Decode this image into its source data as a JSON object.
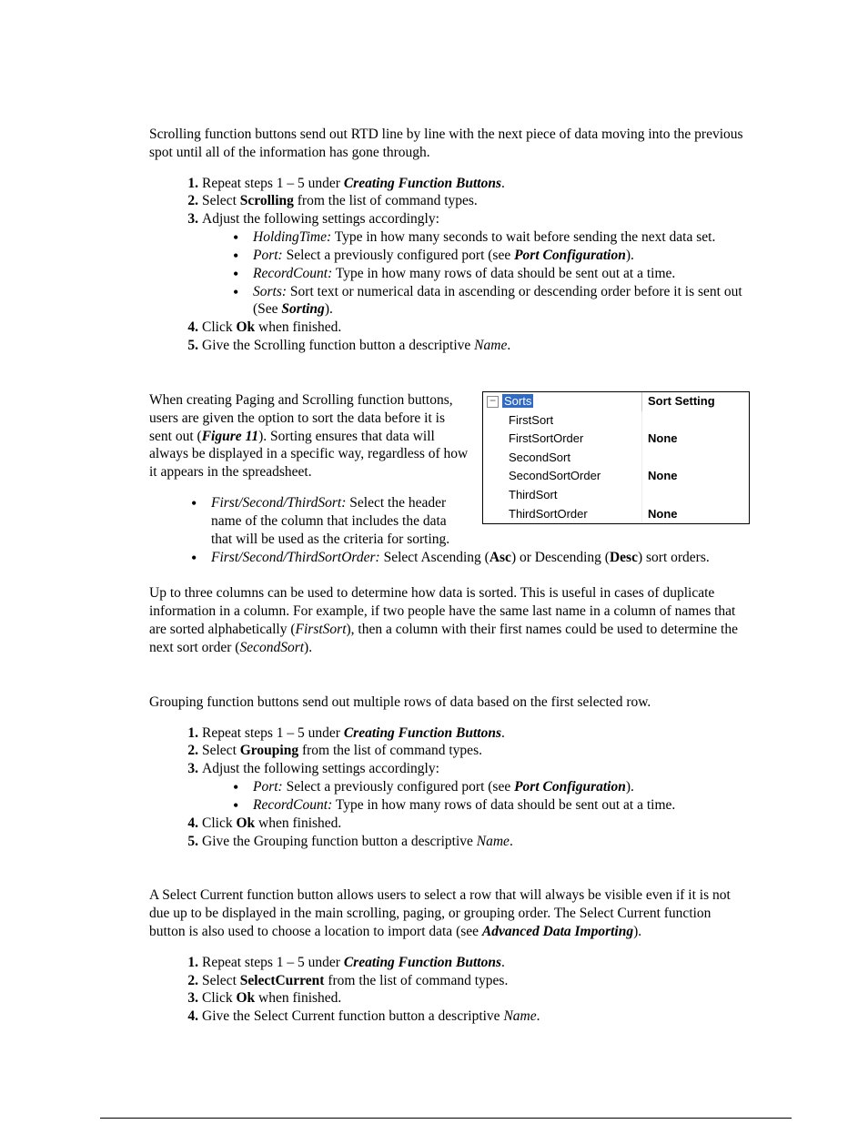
{
  "intro_scrolling": "Scrolling function buttons send out RTD line by line with the next piece of data moving into the previous spot until all of the information has gone through.",
  "scroll_steps": {
    "s1_a": "Repeat steps 1 – 5 under ",
    "s1_b": "Creating Function Buttons",
    "s1_c": ".",
    "s2_a": "Select ",
    "s2_b": "Scrolling",
    "s2_c": " from the list of command types.",
    "s3": "Adjust the following settings accordingly:",
    "s3_items": {
      "holding_lbl": "HoldingTime:",
      "holding_txt": " Type in how many seconds to wait before sending the next data set.",
      "port_lbl": "Port:",
      "port_txt_a": " Select a previously configured port (see ",
      "port_txt_b": "Port Configuration",
      "port_txt_c": ").",
      "rc_lbl": "RecordCount:",
      "rc_txt": " Type in how many rows of data should be sent out at a time.",
      "sorts_lbl": "Sorts:",
      "sorts_txt_a": " Sort text or numerical data in ascending or descending order before it is sent out (See ",
      "sorts_txt_b": "Sorting",
      "sorts_txt_c": ")."
    },
    "s4_a": "Click ",
    "s4_b": "Ok",
    "s4_c": " when finished.",
    "s5_a": "Give the Scrolling function button a descriptive ",
    "s5_b": "Name",
    "s5_c": "."
  },
  "sort_figure": {
    "header_label": "Sorts",
    "header_right": "Sort Setting",
    "rows": [
      {
        "k": "FirstSort",
        "v": ""
      },
      {
        "k": "FirstSortOrder",
        "v": "None"
      },
      {
        "k": "SecondSort",
        "v": ""
      },
      {
        "k": "SecondSortOrder",
        "v": "None"
      },
      {
        "k": "ThirdSort",
        "v": ""
      },
      {
        "k": "ThirdSortOrder",
        "v": "None"
      }
    ]
  },
  "sorting_intro_a": "When creating Paging and Scrolling function buttons, users are given the option to sort the data before it is sent out (",
  "sorting_intro_b": "Figure 11",
  "sorting_intro_c": "). Sorting ensures that data will always be displayed in a specific way, regardless of how it appears in the spreadsheet.",
  "sort_bullets": {
    "b1_lbl": "First/Second/ThirdSort:",
    "b1_txt": " Select the header name of the column that includes the data that will be used as the criteria for sorting.",
    "b2_lbl": "First/Second/ThirdSortOrder:",
    "b2_txt_a": " Select Ascending (",
    "b2_asc": "Asc",
    "b2_txt_b": ") or Descending (",
    "b2_desc": "Desc",
    "b2_txt_c": ") sort orders."
  },
  "sorting_para_a": "Up to three columns can be used to determine how data is sorted. This is useful in cases of duplicate information in a column. For example, if two people have the same last name in a column of names that are sorted alphabetically (",
  "sorting_para_b": "FirstSort",
  "sorting_para_c": "), then a column with their first names could be used to determine the next sort order (",
  "sorting_para_d": "SecondSort",
  "sorting_para_e": ").",
  "grouping_intro": "Grouping function buttons send out multiple rows of data based on the first selected row.",
  "group_steps": {
    "s1_a": "Repeat steps 1 – 5 under ",
    "s1_b": "Creating Function Buttons",
    "s1_c": ".",
    "s2_a": "Select ",
    "s2_b": "Grouping",
    "s2_c": " from the list of command types.",
    "s3": "Adjust the following settings accordingly:",
    "s3_items": {
      "port_lbl": "Port:",
      "port_txt_a": " Select a previously configured port (see ",
      "port_txt_b": "Port Configuration",
      "port_txt_c": ").",
      "rc_lbl": "RecordCount:",
      "rc_txt": " Type in how many rows of data should be sent out at a time."
    },
    "s4_a": "Click ",
    "s4_b": "Ok",
    "s4_c": " when finished.",
    "s5_a": "Give the Grouping function button a descriptive ",
    "s5_b": "Name",
    "s5_c": "."
  },
  "select_intro_a": "A Select Current function button allows users to select  a row that will always be visible even if it is not due up to be displayed in the main scrolling, paging, or grouping order. The Select Current function button is also used to choose a location to import data (see ",
  "select_intro_b": "Advanced Data Importing",
  "select_intro_c": ").",
  "select_steps": {
    "s1_a": "Repeat steps 1 – 5 under ",
    "s1_b": "Creating Function Buttons",
    "s1_c": ".",
    "s2_a": "Select ",
    "s2_b": "SelectCurrent",
    "s2_c": " from the list of command types.",
    "s3_a": "Click ",
    "s3_b": "Ok",
    "s3_c": " when finished.",
    "s4_a": "Give the Select Current function button a descriptive ",
    "s4_b": "Name",
    "s4_c": "."
  }
}
